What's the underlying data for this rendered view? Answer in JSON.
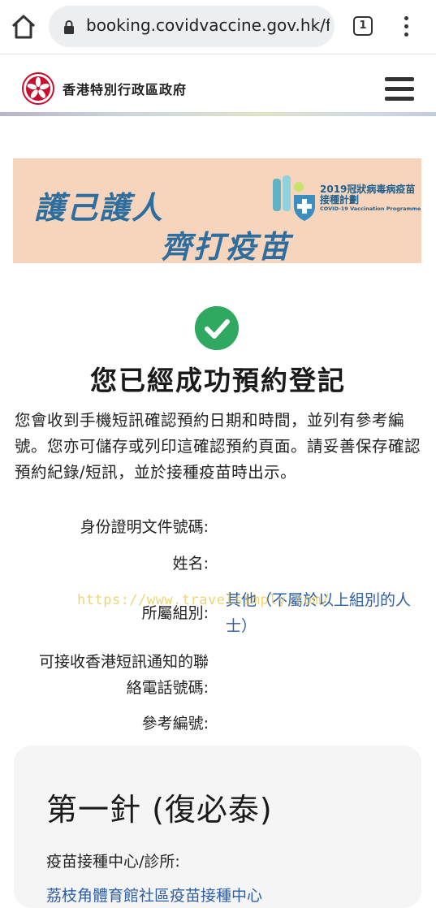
{
  "browser": {
    "url": "booking.covidvaccine.gov.hk/fo",
    "tab_count": "1"
  },
  "header": {
    "gov_name": "香港特別行政區政府"
  },
  "banner": {
    "slogan_line1": "護己護人",
    "slogan_line2": "齊打疫苗",
    "programme_zh": "2019冠狀病毒病疫苗接種計劃",
    "programme_en": "COVID-19 Vaccination Programme"
  },
  "confirmation": {
    "title": "您已經成功預約登記",
    "message": "您會收到手機短訊確認預約日期和時間，並列有參考編號。您亦可儲存或列印這確認預約頁面。請妥善保存確認預約紀錄/短訊，並於接種疫苗時出示。"
  },
  "details": {
    "id_label": "身份證明文件號碼:",
    "name_label": "姓名:",
    "group_label": "所屬組別:",
    "group_value": "其他（不屬於以上組別的人士）",
    "phone_label_line1": "可接收香港短訊通知的聯",
    "phone_label_line2": "絡電話號碼:",
    "ref_label": "參考編號:"
  },
  "watermark": "https://www.travelsimply.com/",
  "dose": {
    "title": "第一針 (復必泰)",
    "centre_label": "疫苗接種中心/診所:",
    "centre_value": "荔枝角體育館社區疫苗接種中心"
  },
  "colors": {
    "accent_blue": "#2d5ea8",
    "success_green": "#2fa860",
    "banner_bg": "#f7d5bd"
  }
}
